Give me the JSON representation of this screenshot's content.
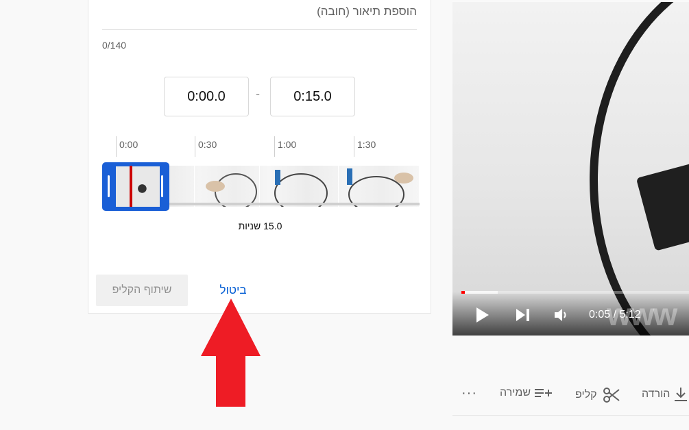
{
  "clip_dialog": {
    "description_placeholder": "הוספת תיאור (חובה)",
    "char_count": "0/140",
    "start_time": "0:00.0",
    "time_separator": "-",
    "end_time": "0:15.0",
    "timeline_ticks": [
      "0:00",
      "0:30",
      "1:00",
      "1:30"
    ],
    "clip_duration": "15.0 שניות",
    "share_label": "שיתוף הקליפ",
    "cancel_label": "ביטול"
  },
  "player": {
    "time_display": "0:05 / 5:12",
    "watermark": "www",
    "progress_fraction": 0.016,
    "buffered_fraction": 0.16
  },
  "actions": {
    "download_label": "הורדה",
    "clip_label": "קליפ",
    "save_label": "שמירה",
    "more_label": "···"
  },
  "colors": {
    "accent_blue": "#065fd4",
    "selection_blue": "#1a5fd6",
    "playhead_red": "#cc0000",
    "annotation_arrow": "#ee1c25"
  }
}
